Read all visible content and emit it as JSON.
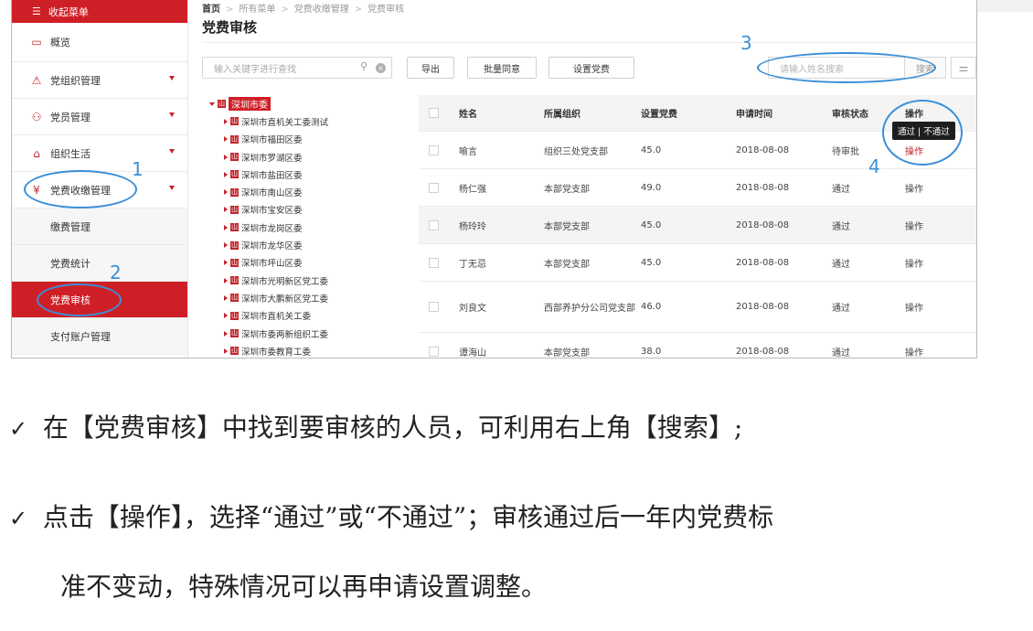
{
  "sidebar": {
    "collapse_label": "收起菜单",
    "items": [
      {
        "label": "概览",
        "icon": "calendar-icon",
        "glyph": "▭"
      },
      {
        "label": "党组织管理",
        "icon": "triangle-icon",
        "glyph": "⚠"
      },
      {
        "label": "党员管理",
        "icon": "people-icon",
        "glyph": "⚇"
      },
      {
        "label": "组织生活",
        "icon": "home-icon",
        "glyph": "⌂"
      },
      {
        "label": "党费收缴管理",
        "icon": "yuan-icon",
        "glyph": "¥"
      }
    ],
    "subitems": [
      "缴费管理",
      "党费统计",
      "党费审核",
      "支付账户管理"
    ]
  },
  "breadcrumb": {
    "home": "首页",
    "l1": "所有菜单",
    "l2": "党费收缴管理",
    "l3": "党费审核"
  },
  "page_title": "党费审核",
  "toolbar": {
    "keyword_placeholder": "输入关键字进行查找",
    "export": "导出",
    "batch_approve": "批量同意",
    "set_fee": "设置党费",
    "search_placeholder": "请输入姓名搜索",
    "search_button": "搜索"
  },
  "tree": {
    "root": "深圳市委",
    "children": [
      "深圳市直机关工委测试",
      "深圳市福田区委",
      "深圳市罗湖区委",
      "深圳市盐田区委",
      "深圳市南山区委",
      "深圳市宝安区委",
      "深圳市龙岗区委",
      "深圳市龙华区委",
      "深圳市坪山区委",
      "深圳市光明新区党工委",
      "深圳市大鹏新区党工委",
      "深圳市直机关工委",
      "深圳市委两新组织工委",
      "深圳市委教育工委"
    ]
  },
  "table": {
    "headers": [
      "姓名",
      "所属组织",
      "设置党费",
      "申请时间",
      "审核状态",
      "操作"
    ],
    "rows": [
      {
        "name": "喻言",
        "org": "组织三处党支部",
        "fee": "45.0",
        "date": "2018-08-08",
        "status": "待审批",
        "op": "操作"
      },
      {
        "name": "杨仁强",
        "org": "本部党支部",
        "fee": "49.0",
        "date": "2018-08-08",
        "status": "通过",
        "op": "操作"
      },
      {
        "name": "杨玲玲",
        "org": "本部党支部",
        "fee": "45.0",
        "date": "2018-08-08",
        "status": "通过",
        "op": "操作"
      },
      {
        "name": "丁无忌",
        "org": "本部党支部",
        "fee": "45.0",
        "date": "2018-08-08",
        "status": "通过",
        "op": "操作"
      },
      {
        "name": "刘良文",
        "org": "西部养护分公司党支部",
        "fee": "46.0",
        "date": "2018-08-08",
        "status": "通过",
        "op": "操作"
      },
      {
        "name": "谭海山",
        "org": "本部党支部",
        "fee": "38.0",
        "date": "2018-08-08",
        "status": "通过",
        "op": "操作"
      }
    ]
  },
  "tooltip": "通过 | 不通过",
  "annotations": [
    "1",
    "2",
    "3",
    "4"
  ],
  "instructions": {
    "check": "✓",
    "line1": "在【党费审核】中找到要审核的人员，可利用右上角【搜索】;",
    "line2": "点击【操作】，选择“通过”或“不通过”；审核通过后一年内党费标",
    "line3": "准不变动，特殊情况可以再申请设置调整。"
  },
  "colors": {
    "brand_red": "#cf1f26",
    "annotation_blue": "#3a8fd8"
  }
}
